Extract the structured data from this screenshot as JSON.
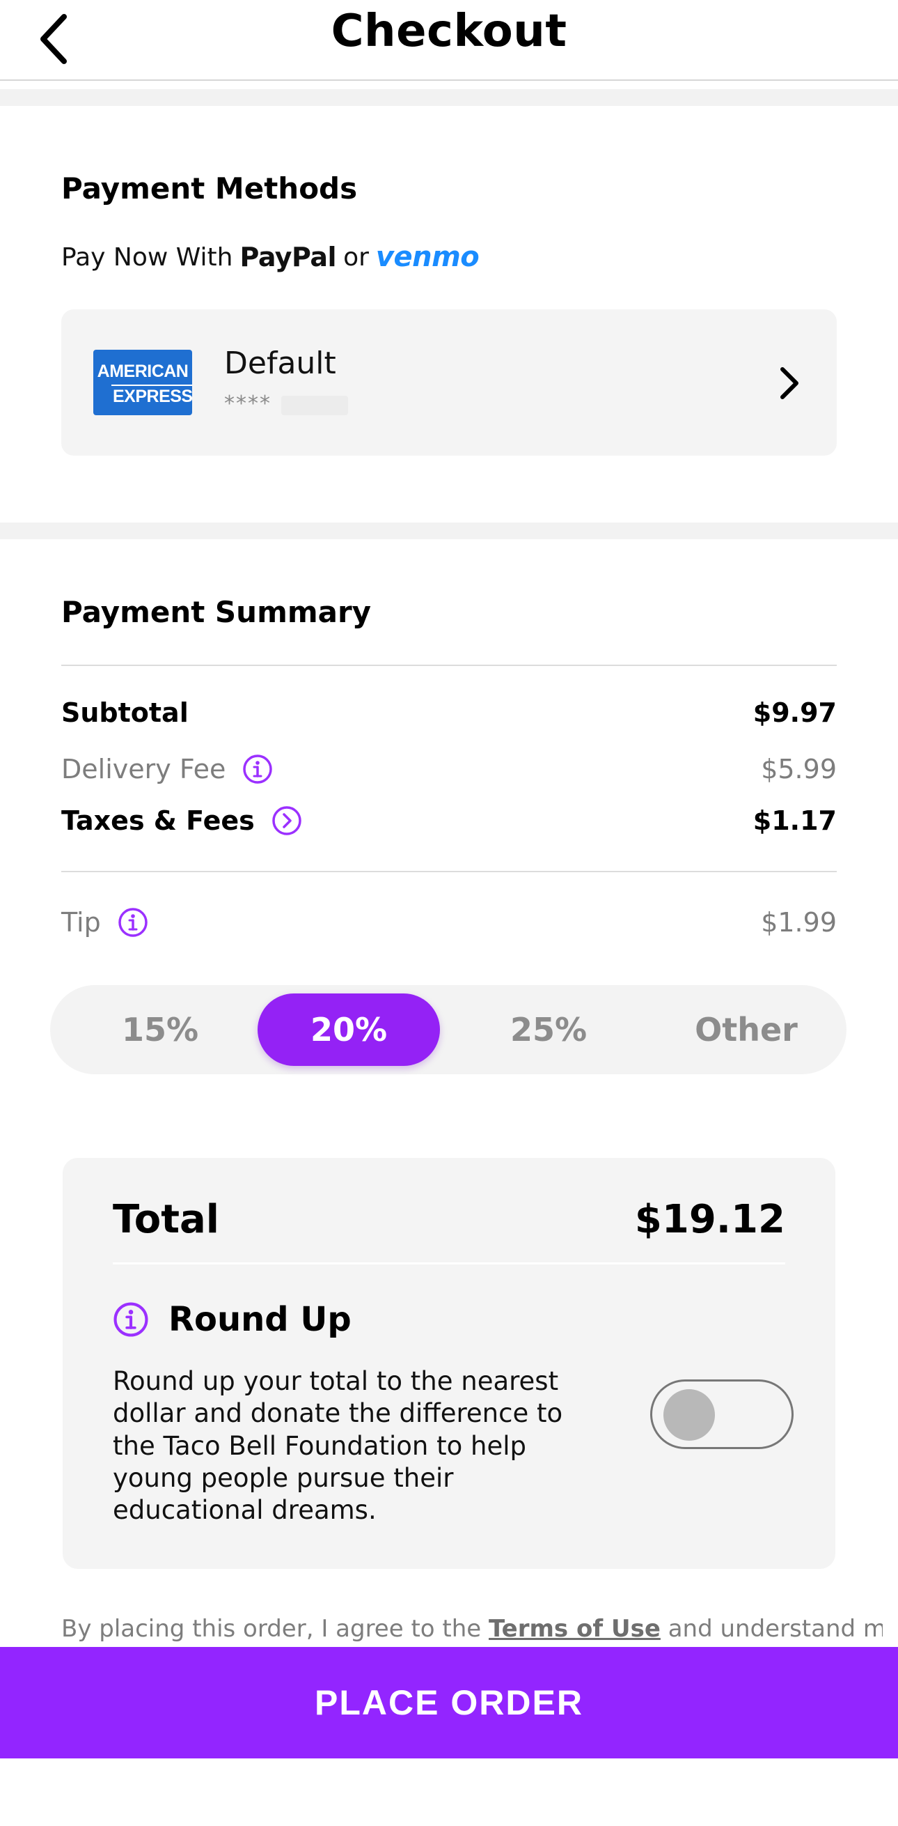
{
  "header": {
    "title": "Checkout"
  },
  "payment_methods": {
    "title": "Payment Methods",
    "pay_now_prefix": "Pay Now With",
    "paypal_label": "PayPal",
    "or_text": "or",
    "venmo_label": "venmo",
    "card": {
      "brand_line1": "AMERICAN",
      "brand_line2": "EXPRESS",
      "name": "Default",
      "mask": "****"
    }
  },
  "summary": {
    "title": "Payment Summary",
    "subtotal_label": "Subtotal",
    "subtotal_value": "$9.97",
    "delivery_label": "Delivery Fee",
    "delivery_value": "$5.99",
    "taxes_label": "Taxes & Fees",
    "taxes_value": "$1.17",
    "tip_label": "Tip",
    "tip_value": "$1.99"
  },
  "tip_options": [
    "15%",
    "20%",
    "25%",
    "Other"
  ],
  "tip_selected": "20%",
  "total": {
    "label": "Total",
    "value": "$19.12"
  },
  "round_up": {
    "title": "Round Up",
    "description": "Round up your total to the nearest dollar and donate the difference to the Taco Bell Foundation to help young people pursue their educational dreams.",
    "enabled": false
  },
  "legal": {
    "prefix": "By placing this order, I agree to the",
    "terms_link": "Terms of Use",
    "suffix": "and understand my"
  },
  "place_order_label": "PLACE ORDER",
  "colors": {
    "accent": "#9422f5",
    "info_icon": "#9b30ff",
    "venmo": "#1a8cff",
    "amex": "#1f6fd1"
  }
}
